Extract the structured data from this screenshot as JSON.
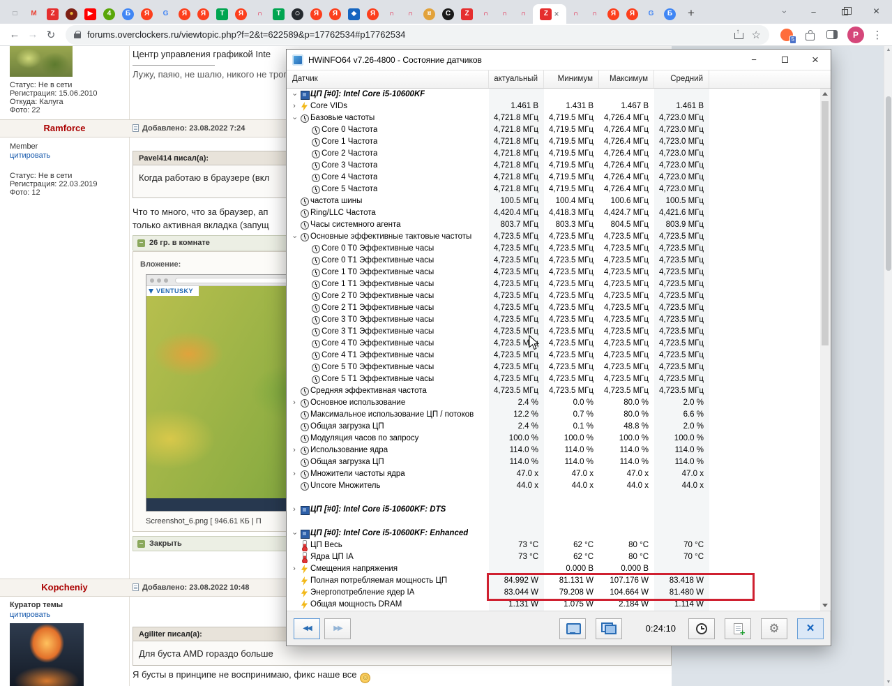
{
  "icons": {
    "window": "□",
    "minimize": "−",
    "close": "×",
    "chevron": "›",
    "back": "←",
    "forward": "→",
    "reload": "↻",
    "star": "☆",
    "menu": "⋮",
    "new_tab": "+",
    "gear": "⚙",
    "double_left": "◀◀",
    "double_right": "▶▶",
    "smiley": "☺",
    "spoiler_minus": "−",
    "tree_chevron": "›"
  },
  "browser": {
    "url": "forums.overclockers.ru/viewtopic.php?f=2&t=622589&p=17762534#p17762534",
    "profile_initial": "P",
    "ext_badge": "5",
    "tabs": [
      {
        "g": "□",
        "fg": "#7a7f85"
      },
      {
        "g": "M",
        "fg": "#ea4335"
      },
      {
        "g": "Z",
        "fg": "#ffffff",
        "bg": "#e52e2e",
        "sq": true
      },
      {
        "g": "●",
        "fg": "#e8b73a",
        "bg": "#7c1f14"
      },
      {
        "g": "▶",
        "fg": "#ffffff",
        "bg": "#ff0000",
        "sq": true
      },
      {
        "g": "4",
        "fg": "#ffffff",
        "bg": "#59a608"
      },
      {
        "g": "Б",
        "fg": "#ffffff",
        "bg": "#4086f4"
      },
      {
        "g": "Я",
        "fg": "#ffffff",
        "bg": "#fc3f1d"
      },
      {
        "g": "G",
        "fg": "#4285f4"
      },
      {
        "g": "Я",
        "fg": "#ffffff",
        "bg": "#fc3f1d"
      },
      {
        "g": "Я",
        "fg": "#ffffff",
        "bg": "#fc3f1d"
      },
      {
        "g": "Т",
        "fg": "#ffffff",
        "bg": "#00a550",
        "sq": true
      },
      {
        "g": "Я",
        "fg": "#ffffff",
        "bg": "#fc3f1d"
      },
      {
        "g": "∩",
        "fg": "#e4002b"
      },
      {
        "g": "Т",
        "fg": "#ffffff",
        "bg": "#00a550",
        "sq": true
      },
      {
        "g": "☺",
        "fg": "#ffffff",
        "bg": "#24292e"
      },
      {
        "g": "Я",
        "fg": "#ffffff",
        "bg": "#fc3f1d"
      },
      {
        "g": "Я",
        "fg": "#ffffff",
        "bg": "#fc3f1d"
      },
      {
        "g": "◆",
        "fg": "#ffffff",
        "bg": "#1565c0",
        "sq": true
      },
      {
        "g": "Я",
        "fg": "#ffffff",
        "bg": "#fc3f1d"
      },
      {
        "g": "∩",
        "fg": "#e4002b"
      },
      {
        "g": "∩",
        "fg": "#e4002b"
      },
      {
        "g": "¤",
        "fg": "#ffffff",
        "bg": "#e2a23b"
      },
      {
        "g": "C",
        "fg": "#ffffff",
        "bg": "#1a1a1a"
      },
      {
        "g": "Z",
        "fg": "#ffffff",
        "bg": "#e52e2e",
        "sq": true
      },
      {
        "g": "∩",
        "fg": "#e4002b"
      },
      {
        "g": "∩",
        "fg": "#e4002b"
      },
      {
        "g": "∩",
        "fg": "#e4002b"
      },
      {
        "g": "Z",
        "fg": "#ffffff",
        "bg": "#e52e2e",
        "sq": true,
        "active": true
      },
      {
        "g": "∩",
        "fg": "#e4002b"
      },
      {
        "g": "∩",
        "fg": "#e4002b"
      },
      {
        "g": "Я",
        "fg": "#ffffff",
        "bg": "#fc3f1d"
      },
      {
        "g": "Я",
        "fg": "#ffffff",
        "bg": "#fc3f1d"
      },
      {
        "g": "G",
        "fg": "#4285f4"
      },
      {
        "g": "Б",
        "fg": "#ffffff",
        "bg": "#4086f4"
      }
    ]
  },
  "forum": {
    "prev_post": {
      "sig_line1": "Центр управления графикой Inte",
      "sig_line2": "Лужу, паяю, не шалю, никого не трога",
      "status": "Статус: Не в сети",
      "registered": "Регистрация: 15.06.2010",
      "from": "Откуда: Калуга",
      "photos": "Фото: 22"
    },
    "post_ramforce": {
      "username": "Ramforce",
      "rank": "Member",
      "quote_link": "цитировать",
      "status": "Статус: Не в сети",
      "registered": "Регистрация: 22.03.2019",
      "photos": "Фото: 12",
      "added": "Добавлено: 23.08.2022 7:24",
      "quote_header": "Pavel414 писал(а):",
      "quote_body": "Когда работаю в браузере (вкл",
      "body_lines": [
        "Что то много, что за браузер, ап",
        "только активная вкладка (запущ"
      ],
      "spoiler_label": "26 гр. в комнате",
      "attachment_label": "Вложение:",
      "screenshot_brand": "VENTUSKY",
      "attachment_caption": "Screenshot_6.png [ 946.61 КБ | П",
      "close_label": "Закрыть"
    },
    "post_kopcheniy": {
      "username": "Kopcheniy",
      "rank": "Куратор темы",
      "quote_link": "цитировать",
      "added": "Добавлено: 23.08.2022 10:48",
      "quote_header": "Agiliter писал(а):",
      "quote_body": "Для буста AMD гораздо больше",
      "body": "Я бусты в принципе не воспринимаю, фикс наше все"
    }
  },
  "hwinfo": {
    "title": "HWiNFO64 v7.26-4800 - Состояние датчиков",
    "columns": [
      "Датчик",
      "актуальный",
      "Минимум",
      "Максимум",
      "Средний"
    ],
    "timer": "0:24:10",
    "highlight_color": "#cf2030",
    "rows": [
      {
        "t": "sec",
        "a": "d",
        "i": "chip",
        "l": "ЦП [#0]: Intel Core i5-10600KF"
      },
      {
        "a": "r",
        "i": "bolt",
        "l": "Core VIDs",
        "v": [
          "1.461 В",
          "1.431 В",
          "1.467 В",
          "1.461 В"
        ]
      },
      {
        "a": "d",
        "i": "clock",
        "l": "Базовые частоты",
        "v": [
          "4,721.8 МГц",
          "4,719.5 МГц",
          "4,726.4 МГц",
          "4,723.0 МГц"
        ]
      },
      {
        "n": 1,
        "i": "clock",
        "l": "Core 0 Частота",
        "v": [
          "4,721.8 МГц",
          "4,719.5 МГц",
          "4,726.4 МГц",
          "4,723.0 МГц"
        ]
      },
      {
        "n": 1,
        "i": "clock",
        "l": "Core 1 Частота",
        "v": [
          "4,721.8 МГц",
          "4,719.5 МГц",
          "4,726.4 МГц",
          "4,723.0 МГц"
        ]
      },
      {
        "n": 1,
        "i": "clock",
        "l": "Core 2 Частота",
        "v": [
          "4,721.8 МГц",
          "4,719.5 МГц",
          "4,726.4 МГц",
          "4,723.0 МГц"
        ]
      },
      {
        "n": 1,
        "i": "clock",
        "l": "Core 3 Частота",
        "v": [
          "4,721.8 МГц",
          "4,719.5 МГц",
          "4,726.4 МГц",
          "4,723.0 МГц"
        ]
      },
      {
        "n": 1,
        "i": "clock",
        "l": "Core 4 Частота",
        "v": [
          "4,721.8 МГц",
          "4,719.5 МГц",
          "4,726.4 МГц",
          "4,723.0 МГц"
        ]
      },
      {
        "n": 1,
        "i": "clock",
        "l": "Core 5 Частота",
        "v": [
          "4,721.8 МГц",
          "4,719.5 МГц",
          "4,726.4 МГц",
          "4,723.0 МГц"
        ]
      },
      {
        "i": "clock",
        "l": "частота шины",
        "v": [
          "100.5 МГц",
          "100.4 МГц",
          "100.6 МГц",
          "100.5 МГц"
        ]
      },
      {
        "i": "clock",
        "l": "Ring/LLC Частота",
        "v": [
          "4,420.4 МГц",
          "4,418.3 МГц",
          "4,424.7 МГц",
          "4,421.6 МГц"
        ]
      },
      {
        "i": "clock",
        "l": "Часы системного агента",
        "v": [
          "803.7 МГц",
          "803.3 МГц",
          "804.5 МГц",
          "803.9 МГц"
        ]
      },
      {
        "a": "d",
        "i": "clock",
        "l": "Основные эффективные тактовые частоты",
        "v": [
          "4,723.5 МГц",
          "4,723.5 МГц",
          "4,723.5 МГц",
          "4,723.5 МГц"
        ]
      },
      {
        "n": 1,
        "i": "clock",
        "l": "Core 0 T0 Эффективные часы",
        "v": [
          "4,723.5 МГц",
          "4,723.5 МГц",
          "4,723.5 МГц",
          "4,723.5 МГц"
        ]
      },
      {
        "n": 1,
        "i": "clock",
        "l": "Core 0 T1 Эффективные часы",
        "v": [
          "4,723.5 МГц",
          "4,723.5 МГц",
          "4,723.5 МГц",
          "4,723.5 МГц"
        ]
      },
      {
        "n": 1,
        "i": "clock",
        "l": "Core 1 T0 Эффективные часы",
        "v": [
          "4,723.5 МГц",
          "4,723.5 МГц",
          "4,723.5 МГц",
          "4,723.5 МГц"
        ]
      },
      {
        "n": 1,
        "i": "clock",
        "l": "Core 1 T1 Эффективные часы",
        "v": [
          "4,723.5 МГц",
          "4,723.5 МГц",
          "4,723.5 МГц",
          "4,723.5 МГц"
        ]
      },
      {
        "n": 1,
        "i": "clock",
        "l": "Core 2 T0 Эффективные часы",
        "v": [
          "4,723.5 МГц",
          "4,723.5 МГц",
          "4,723.5 МГц",
          "4,723.5 МГц"
        ]
      },
      {
        "n": 1,
        "i": "clock",
        "l": "Core 2 T1 Эффективные часы",
        "v": [
          "4,723.5 МГц",
          "4,723.5 МГц",
          "4,723.5 МГц",
          "4,723.5 МГц"
        ]
      },
      {
        "n": 1,
        "i": "clock",
        "l": "Core 3 T0 Эффективные часы",
        "v": [
          "4,723.5 МГц",
          "4,723.5 МГц",
          "4,723.5 МГц",
          "4,723.5 МГц"
        ]
      },
      {
        "n": 1,
        "i": "clock",
        "l": "Core 3 T1 Эффективные часы",
        "v": [
          "4,723.5 МГц",
          "4,723.5 МГц",
          "4,723.5 МГц",
          "4,723.5 МГц"
        ]
      },
      {
        "n": 1,
        "i": "clock",
        "l": "Core 4 T0 Эффективные часы",
        "v": [
          "4,723.5 МГц",
          "4,723.5 МГц",
          "4,723.5 МГц",
          "4,723.5 МГц"
        ]
      },
      {
        "n": 1,
        "i": "clock",
        "l": "Core 4 T1 Эффективные часы",
        "v": [
          "4,723.5 МГц",
          "4,723.5 МГц",
          "4,723.5 МГц",
          "4,723.5 МГц"
        ]
      },
      {
        "n": 1,
        "i": "clock",
        "l": "Core 5 T0 Эффективные часы",
        "v": [
          "4,723.5 МГц",
          "4,723.5 МГц",
          "4,723.5 МГц",
          "4,723.5 МГц"
        ]
      },
      {
        "n": 1,
        "i": "clock",
        "l": "Core 5 T1 Эффективные часы",
        "v": [
          "4,723.5 МГц",
          "4,723.5 МГц",
          "4,723.5 МГц",
          "4,723.5 МГц"
        ]
      },
      {
        "i": "clock",
        "l": "Средняя эффективная частота",
        "v": [
          "4,723.5 МГц",
          "4,723.5 МГц",
          "4,723.5 МГц",
          "4,723.5 МГц"
        ]
      },
      {
        "a": "r",
        "i": "clock",
        "l": "Основное использование",
        "v": [
          "2.4 %",
          "0.0 %",
          "80.0 %",
          "2.0 %"
        ]
      },
      {
        "i": "clock",
        "l": "Максимальное использование ЦП / потоков",
        "v": [
          "12.2 %",
          "0.7 %",
          "80.0 %",
          "6.6 %"
        ]
      },
      {
        "i": "clock",
        "l": "Общая загрузка ЦП",
        "v": [
          "2.4 %",
          "0.1 %",
          "48.8 %",
          "2.0 %"
        ]
      },
      {
        "i": "clock",
        "l": "Модуляция часов по запросу",
        "v": [
          "100.0 %",
          "100.0 %",
          "100.0 %",
          "100.0 %"
        ]
      },
      {
        "a": "r",
        "i": "clock",
        "l": "Использование ядра",
        "v": [
          "114.0 %",
          "114.0 %",
          "114.0 %",
          "114.0 %"
        ]
      },
      {
        "i": "clock",
        "l": "Общая загрузка ЦП",
        "v": [
          "114.0 %",
          "114.0 %",
          "114.0 %",
          "114.0 %"
        ]
      },
      {
        "a": "r",
        "i": "clock",
        "l": "Множители частоты ядра",
        "v": [
          "47.0 x",
          "47.0 x",
          "47.0 x",
          "47.0 x"
        ]
      },
      {
        "i": "clock",
        "l": "Uncore Множитель",
        "v": [
          "44.0 x",
          "44.0 x",
          "44.0 x",
          "44.0 x"
        ]
      },
      {
        "t": "sp"
      },
      {
        "t": "sec",
        "a": "r",
        "i": "chip",
        "l": "ЦП [#0]: Intel Core i5-10600KF: DTS"
      },
      {
        "t": "sp"
      },
      {
        "t": "sec",
        "a": "d",
        "i": "chip",
        "l": "ЦП [#0]: Intel Core i5-10600KF: Enhanced"
      },
      {
        "i": "therm",
        "l": "ЦП Весь",
        "v": [
          "73 °C",
          "62 °C",
          "80 °C",
          "70 °C"
        ]
      },
      {
        "i": "therm",
        "l": "Ядра ЦП IA",
        "v": [
          "73 °C",
          "62 °C",
          "80 °C",
          "70 °C"
        ]
      },
      {
        "a": "r",
        "i": "bolt",
        "l": "Смещения напряжения",
        "v": [
          "",
          "0.000 В",
          "0.000 В",
          ""
        ]
      },
      {
        "i": "bolt",
        "l": "Полная потребляемая мощность ЦП",
        "v": [
          "84.992 W",
          "81.131 W",
          "107.176 W",
          "83.418 W"
        ],
        "hl": true
      },
      {
        "i": "bolt",
        "l": "Энергопотребление ядер IA",
        "v": [
          "83.044 W",
          "79.208 W",
          "104.664 W",
          "81.480 W"
        ],
        "hl": true
      },
      {
        "i": "bolt",
        "l": "Общая мощность DRAM",
        "v": [
          "1.131 W",
          "1.075 W",
          "2.184 W",
          "1.114 W"
        ]
      }
    ]
  }
}
